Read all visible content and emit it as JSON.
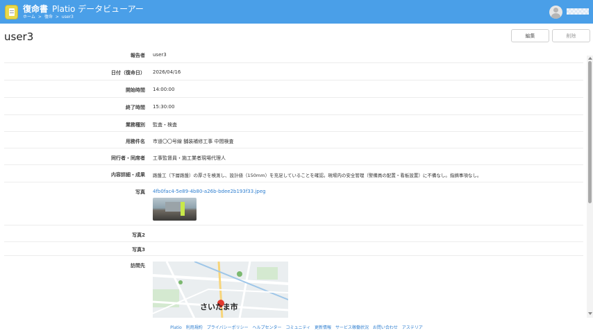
{
  "header": {
    "app_name": "復命書",
    "app_subtitle": "Platio データビューアー",
    "breadcrumbs": [
      "ホーム",
      "復命",
      "user3"
    ],
    "user_name": ""
  },
  "page": {
    "title": "user3",
    "edit_label": "編集",
    "delete_label": "削除"
  },
  "fields": [
    {
      "label": "報告者",
      "value": "user3"
    },
    {
      "label": "日付（復命日）",
      "value": "2026/04/16"
    },
    {
      "label": "開始時間",
      "value": "14:00:00"
    },
    {
      "label": "終了時間",
      "value": "15:30:00"
    },
    {
      "label": "業務種別",
      "value": "監査・検査"
    },
    {
      "label": "用務件名",
      "value": "市道〇〇号線 舗装補修工事 中間検査"
    },
    {
      "label": "同行者・同席者",
      "value": "工事監督員・施工業者現場代理人"
    },
    {
      "label": "内容詳細・成果",
      "value": "路盤工（下層路盤）の厚さを検測し、設計値（150mm）を充足していることを確認。現場内の安全管理（警備員の配置・看板設置）に不備なし。指摘事項なし。"
    },
    {
      "label": "写真",
      "value": "4fb0fac4-5e89-4b80-a26b-bdee2b193f33.jpeg"
    },
    {
      "label": "写真2",
      "value": ""
    },
    {
      "label": "写真3",
      "value": ""
    },
    {
      "label": "訪問先",
      "value": ""
    }
  ],
  "map": {
    "city_label": "さいたま市"
  },
  "footer": {
    "links": [
      "Platio",
      "利用規約",
      "プライバシーポリシー",
      "ヘルプセンター",
      "コミュニティ",
      "更新情報",
      "サービス稼働状況",
      "お問い合わせ",
      "アステリア"
    ]
  }
}
